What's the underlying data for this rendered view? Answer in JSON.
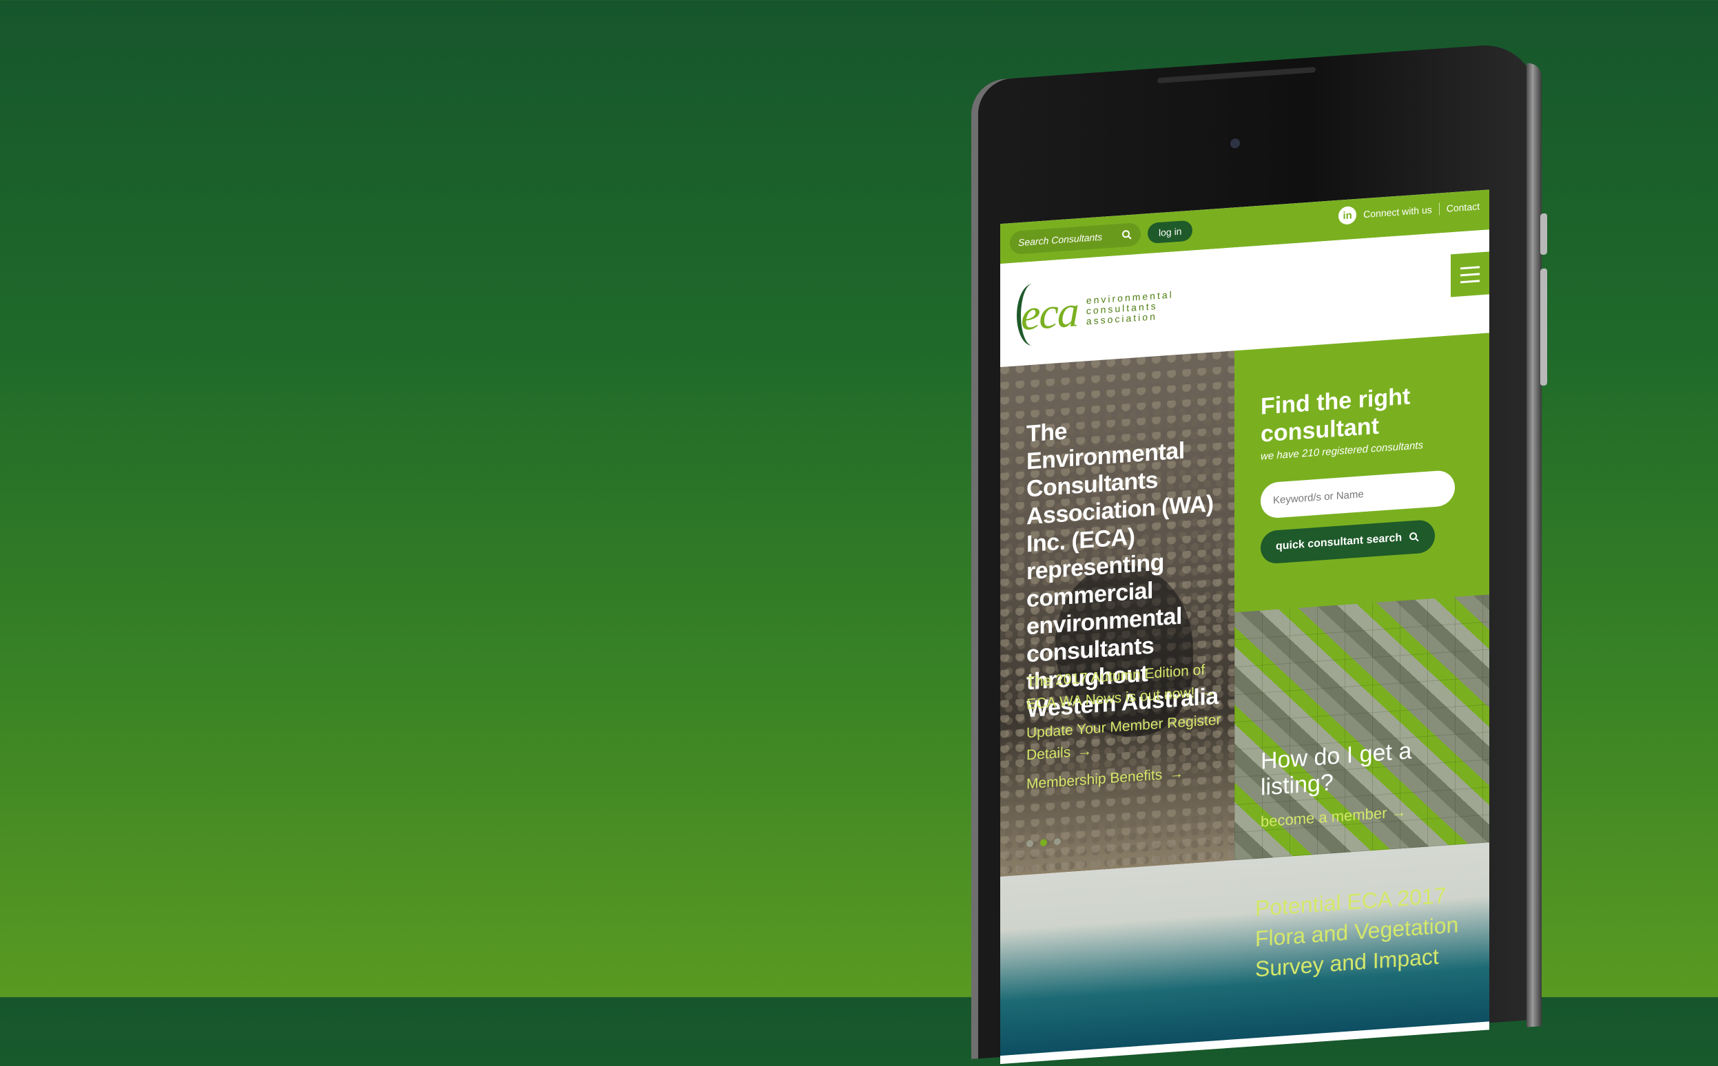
{
  "topbar": {
    "search_placeholder": "Search Consultants",
    "login_label": "log in",
    "connect_label": "Connect with us",
    "contact_label": "Contact"
  },
  "logo": {
    "mark": "eca",
    "words": [
      "environmental",
      "consultants",
      "association"
    ]
  },
  "hero": {
    "title": "The Environmental Consultants Association (WA) Inc. (ECA) representing commercial environmental consultants throughout Western Australia",
    "news": [
      "The 2017 Autumn Edition of ECA WA News is out now!",
      "Update Your Member Register Details",
      "Membership Benefits"
    ],
    "arrow": "→"
  },
  "finder": {
    "title": "Find the right consultant",
    "subtitle": "we have 210 registered consultants",
    "input_placeholder": "Keyword/s or Name",
    "button_label": "quick consultant search"
  },
  "listing": {
    "title": "How do I get a listing?",
    "link_label": "become a member"
  },
  "lower": {
    "heading": "Potential ECA 2017 Flora and Vegetation Survey and Impact"
  },
  "colors": {
    "brand_green": "#7ab020",
    "dark_green": "#1f5a2a",
    "link_yellow": "#d5e86a"
  }
}
